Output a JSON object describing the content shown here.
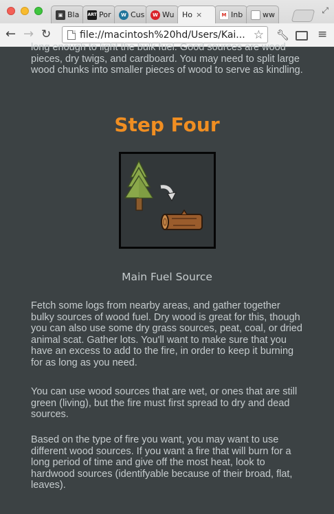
{
  "browser": {
    "tabs": [
      {
        "label": "Bla",
        "favicon": "film-icon",
        "color": "#3a3a3a",
        "glyph": "▣"
      },
      {
        "label": "Por",
        "favicon": "art-330-icon",
        "color": "#1a1a1a",
        "glyph": "ART"
      },
      {
        "label": "Cus",
        "favicon": "wordpress-icon",
        "color": "#21759b",
        "glyph": "W"
      },
      {
        "label": "Wu",
        "favicon": "wunderground-icon",
        "color": "#d9242b",
        "glyph": "W"
      },
      {
        "label": "Ho",
        "favicon": "blank-page-icon",
        "color": "#ffffff",
        "glyph": "",
        "active": true
      },
      {
        "label": "Inb",
        "favicon": "gmail-icon",
        "color": "#d93025",
        "glyph": "M"
      },
      {
        "label": "ww",
        "favicon": "blank-page-icon",
        "color": "#ffffff",
        "glyph": ""
      }
    ],
    "active_tab_close": "×",
    "url": "file://macintosh%20hd/Users/Kai..."
  },
  "page": {
    "intro_text": "long enough to light the bulk fuel. Good sources are wood pieces, dry twigs, and cardboard. You may need to split large wood chunks into smaller pieces of wood to serve as kindling.",
    "step_title": "Step Four",
    "illustration_icon": "tree-to-log-icon",
    "caption": "Main Fuel Source",
    "paragraphs": [
      "Fetch some logs from nearby areas, and gather together bulky sources of wood fuel. Dry wood is great for this, though you can also use some dry grass sources, peat, coal, or dried animal scat. Gather lots. You'll want to make sure that you have an excess to add to the fire, in order to keep it burning for as long as you need.",
      "You can use wood sources that are wet, or ones that are still green (living), but the fire must first spread to dry and dead sources.",
      "Based on the type of fire you want, you may want to use different wood sources. If you want a fire that will burn for a long period of time and give off the most heat, look to hardwood sources (identifyable because of their broad, flat, leaves)."
    ]
  },
  "colors": {
    "background": "#3c4244",
    "body_text": "#c6ccce",
    "accent": "#f08e22"
  }
}
